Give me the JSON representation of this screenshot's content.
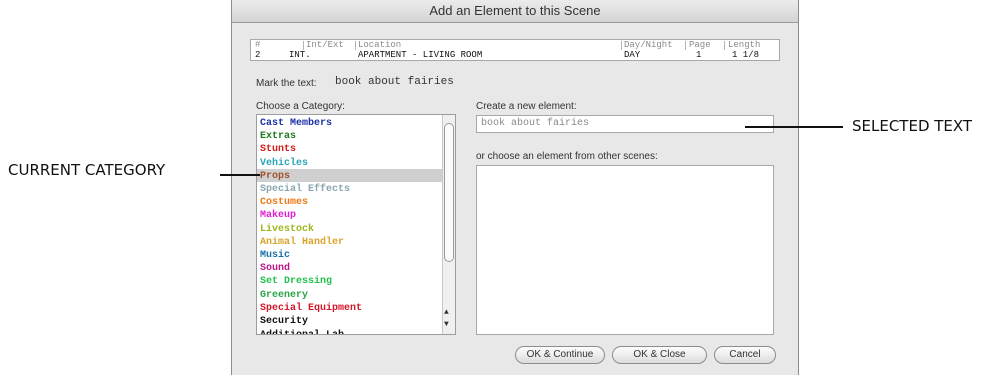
{
  "dialog": {
    "title": "Add an Element to this Scene",
    "table": {
      "headers": [
        "#",
        "Int/Ext",
        "Location",
        "Day/Night",
        "Page",
        "Length"
      ],
      "row": [
        "2",
        "INT.",
        "APARTMENT - LIVING ROOM",
        "DAY",
        "1",
        "1 1/8"
      ]
    },
    "mark_label": "Mark the text:",
    "mark_value": "book about fairies",
    "category_label": "Choose a Category:",
    "new_element_label": "Create a new element:",
    "new_element_value": "book about fairies",
    "other_label": "or choose an element from other scenes:",
    "categories": [
      {
        "label": "Cast Members",
        "color": "#1a2fa8"
      },
      {
        "label": "Extras",
        "color": "#1e7a1e"
      },
      {
        "label": "Stunts",
        "color": "#d31a1a"
      },
      {
        "label": "Vehicles",
        "color": "#2aa5b8"
      },
      {
        "label": "Props",
        "color": "#a0522d"
      },
      {
        "label": "Special Effects",
        "color": "#8aa6b0"
      },
      {
        "label": "Costumes",
        "color": "#ee7a16"
      },
      {
        "label": "Makeup",
        "color": "#e01fd6"
      },
      {
        "label": "Livestock",
        "color": "#9fb51a"
      },
      {
        "label": "Animal Handler",
        "color": "#d8a42a"
      },
      {
        "label": "Music",
        "color": "#1a6fa8"
      },
      {
        "label": "Sound",
        "color": "#c0168a"
      },
      {
        "label": "Set Dressing",
        "color": "#24c24a"
      },
      {
        "label": "Greenery",
        "color": "#2aa54a"
      },
      {
        "label": "Special Equipment",
        "color": "#d3162a"
      },
      {
        "label": "Security",
        "color": "#111111"
      }
    ],
    "selected_category": "Props",
    "buttons": {
      "ok_continue": "OK & Continue",
      "ok_close": "OK & Close",
      "cancel": "Cancel"
    }
  },
  "annotations": {
    "current_category": "CURRENT CATEGORY",
    "selected_text": "SELECTED TEXT"
  }
}
